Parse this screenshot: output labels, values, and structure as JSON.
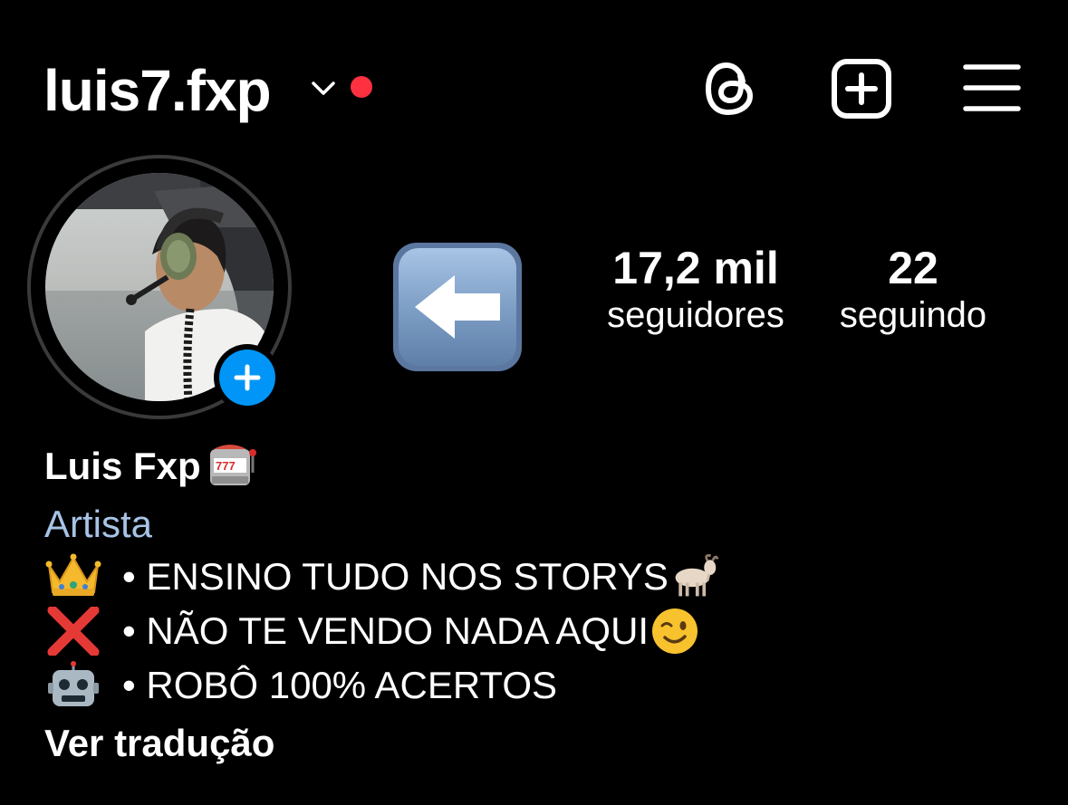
{
  "header": {
    "username": "luis7.fxp",
    "icons": [
      "chevron-down-icon",
      "notification-dot",
      "threads-icon",
      "create-plus-icon",
      "hamburger-menu-icon"
    ],
    "accent_dot_color": "#ff3040"
  },
  "profile": {
    "avatar": "profile-photo",
    "add_story_color": "#0095f6",
    "highlight_emoji": "left-arrow-emoji",
    "followers": {
      "value": "17,2 mil",
      "label": "seguidores"
    },
    "following": {
      "value": "22",
      "label": "seguindo"
    }
  },
  "bio": {
    "display_name": "Luis Fxp",
    "display_name_emoji": "slot-machine-emoji",
    "category": "Artista",
    "category_color": "#a7c3e6",
    "lines": [
      {
        "emoji": "crown-emoji",
        "text": "• ENSINO TUDO NOS STORYS",
        "tail_emoji": "goat-emoji"
      },
      {
        "emoji": "cross-mark-emoji",
        "text": "• NÃO TE VENDO NADA AQUI",
        "tail_emoji": "winking-face-emoji"
      },
      {
        "emoji": "robot-emoji",
        "text": "• ROBÔ 100% ACERTOS",
        "tail_emoji": ""
      }
    ],
    "translate_link": "Ver tradução"
  }
}
